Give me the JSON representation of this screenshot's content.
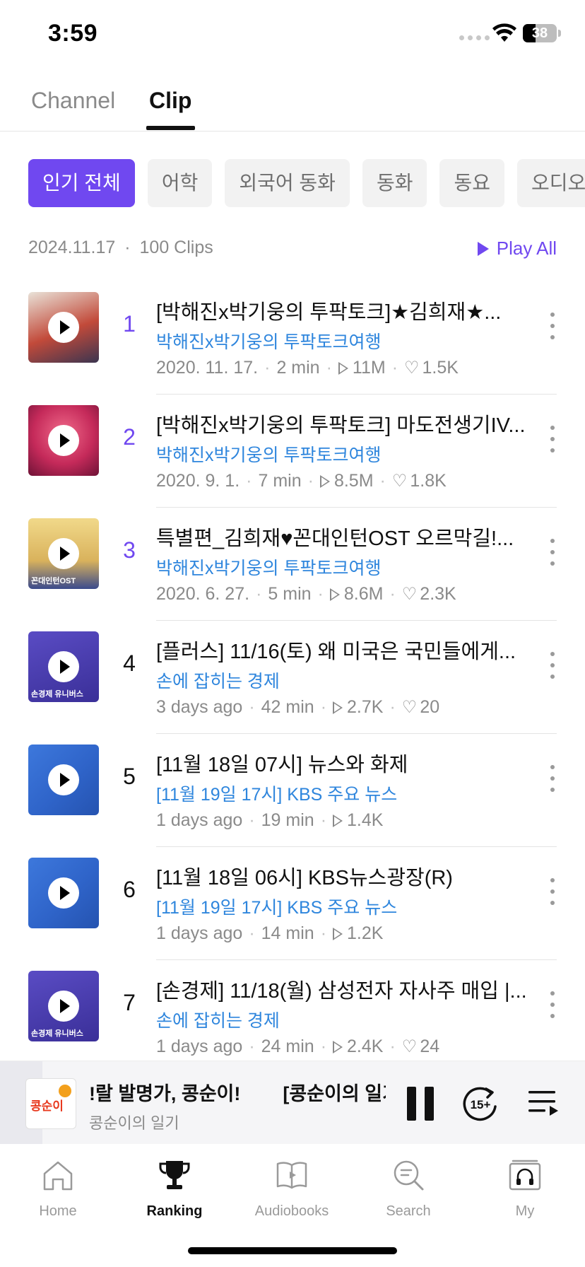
{
  "status": {
    "time": "3:59",
    "battery_level": "38"
  },
  "top_tabs": [
    {
      "label": "Channel",
      "active": false
    },
    {
      "label": "Clip",
      "active": true
    }
  ],
  "chips": [
    {
      "label": "인기 전체",
      "active": true
    },
    {
      "label": "어학",
      "active": false
    },
    {
      "label": "외국어 동화",
      "active": false
    },
    {
      "label": "동화",
      "active": false
    },
    {
      "label": "동요",
      "active": false
    },
    {
      "label": "오디오",
      "active": false
    }
  ],
  "list_header": {
    "date": "2024.11.17",
    "separator": "·",
    "count": "100 Clips",
    "play_all": "Play All"
  },
  "clips": [
    {
      "rank": "1",
      "title": "[박해진x박기웅의 투팍토크]★김희재★...",
      "channel": "박해진x박기웅의 투팍토크여행",
      "date": "2020. 11. 17.",
      "duration": "2 min",
      "plays": "11M",
      "likes": "1.5K",
      "thumb_text": ""
    },
    {
      "rank": "2",
      "title": "[박해진x박기웅의 투팍토크] 마도전생기IV...",
      "channel": "박해진x박기웅의 투팍토크여행",
      "date": "2020. 9. 1.",
      "duration": "7 min",
      "plays": "8.5M",
      "likes": "1.8K",
      "thumb_text": ""
    },
    {
      "rank": "3",
      "title": "특별편_김희재♥꼰대인턴OST 오르막길!...",
      "channel": "박해진x박기웅의 투팍토크여행",
      "date": "2020. 6. 27.",
      "duration": "5 min",
      "plays": "8.6M",
      "likes": "2.3K",
      "thumb_text": "꼰대인턴OST"
    },
    {
      "rank": "4",
      "title": "[플러스] 11/16(토) 왜 미국은 국민들에게...",
      "channel": "손에 잡히는 경제",
      "date": "3 days ago",
      "duration": "42 min",
      "plays": "2.7K",
      "likes": "20",
      "thumb_text": "손경제 유니버스"
    },
    {
      "rank": "5",
      "title": "[11월 18일 07시] 뉴스와 화제",
      "channel": "[11월 19일 17시] KBS 주요 뉴스",
      "date": "1 days ago",
      "duration": "19 min",
      "plays": "1.4K",
      "likes": "",
      "thumb_text": ""
    },
    {
      "rank": "6",
      "title": "[11월 18일 06시] KBS뉴스광장(R)",
      "channel": "[11월 19일 17시] KBS 주요 뉴스",
      "date": "1 days ago",
      "duration": "14 min",
      "plays": "1.2K",
      "likes": "",
      "thumb_text": ""
    },
    {
      "rank": "7",
      "title": "[손경제] 11/18(월) 삼성전자 자사주 매입 |...",
      "channel": "손에 잡히는 경제",
      "date": "1 days ago",
      "duration": "24 min",
      "plays": "2.4K",
      "likes": "24",
      "thumb_text": "손경제 유니버스"
    }
  ],
  "mini_player": {
    "title": "!랄 발명가, 콩순이!        [콩순이의 일기",
    "subtitle": "콩순이의 일기",
    "art_text": "콩순이",
    "skip_label": "15+"
  },
  "nav": [
    {
      "label": "Home",
      "icon": "home-icon",
      "active": false
    },
    {
      "label": "Ranking",
      "icon": "trophy-icon",
      "active": true
    },
    {
      "label": "Audiobooks",
      "icon": "book-icon",
      "active": false
    },
    {
      "label": "Search",
      "icon": "search-icon",
      "active": false
    },
    {
      "label": "My",
      "icon": "headphones-icon",
      "active": false
    }
  ],
  "colors": {
    "accent": "#7048f0",
    "link": "#2f86dd",
    "muted": "#8a8a8a",
    "thumb_1": "#8f4b3f",
    "thumb_2": "#c52a5a",
    "thumb_3": "#d9b25c",
    "thumb_4": "#4b3aa8",
    "thumb_5": "#2f64c9",
    "thumb_6": "#2f64c9",
    "thumb_7": "#4b3aa8"
  }
}
